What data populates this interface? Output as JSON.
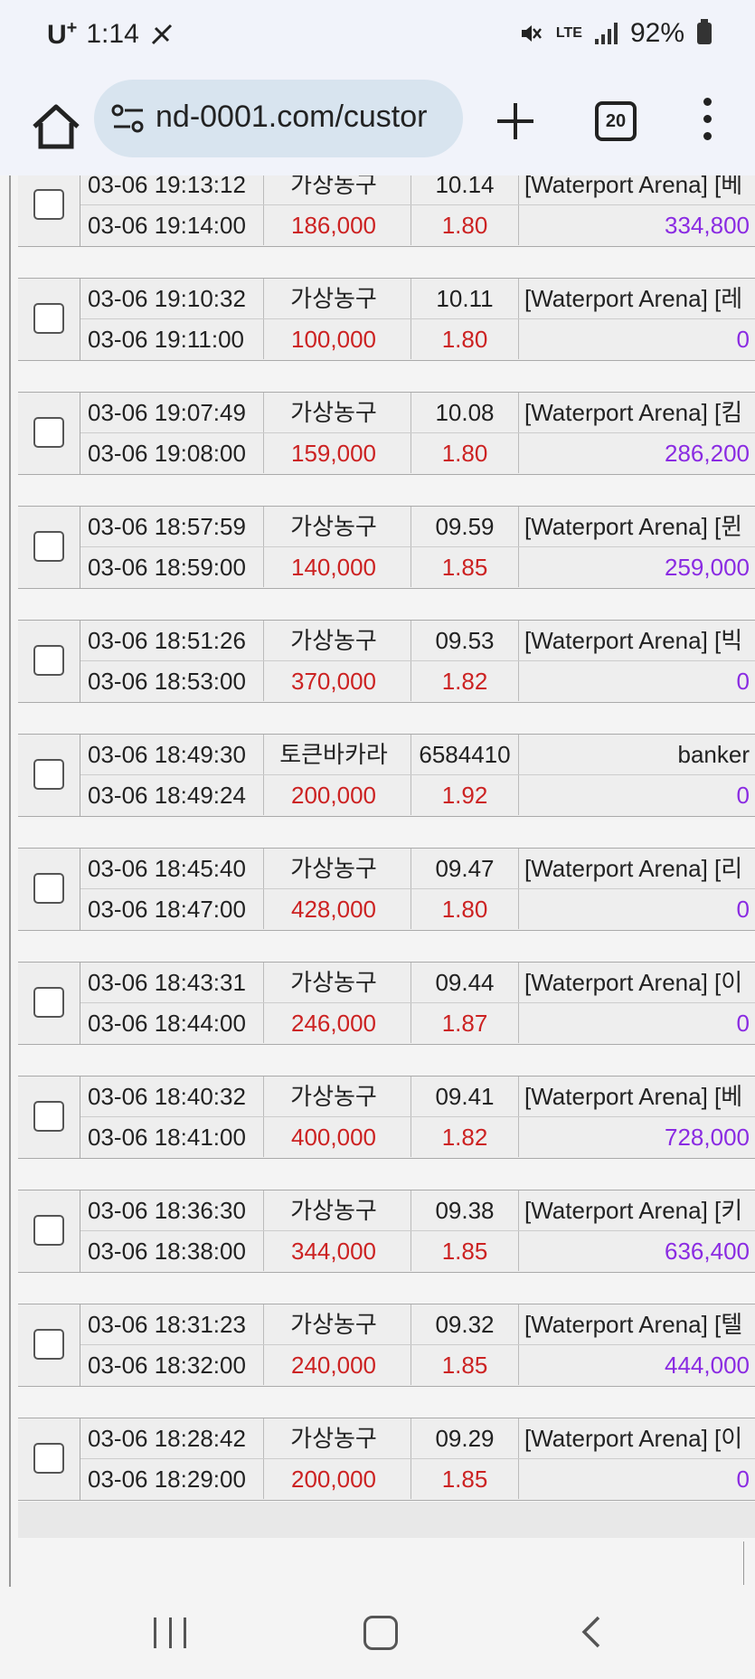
{
  "status_bar": {
    "carrier": "U",
    "carrier_sup": "+",
    "time": "1:14",
    "network": "LTE",
    "battery": "92%"
  },
  "browser": {
    "url": "nd-0001.com/custor",
    "tab_count": "20"
  },
  "rows": [
    {
      "time1": "03-06 19:13:12",
      "game": "가상농구",
      "code": "10.14",
      "desc": "[Waterport Arena] [베",
      "time2": "03-06 19:14:00",
      "amount": "186,000",
      "odds": "1.80",
      "payout": "334,800"
    },
    {
      "time1": "03-06 19:10:32",
      "game": "가상농구",
      "code": "10.11",
      "desc": "[Waterport Arena] [레",
      "time2": "03-06 19:11:00",
      "amount": "100,000",
      "odds": "1.80",
      "payout": "0"
    },
    {
      "time1": "03-06 19:07:49",
      "game": "가상농구",
      "code": "10.08",
      "desc": "[Waterport Arena] [킴",
      "time2": "03-06 19:08:00",
      "amount": "159,000",
      "odds": "1.80",
      "payout": "286,200"
    },
    {
      "time1": "03-06 18:57:59",
      "game": "가상농구",
      "code": "09.59",
      "desc": "[Waterport Arena] [뮌",
      "time2": "03-06 18:59:00",
      "amount": "140,000",
      "odds": "1.85",
      "payout": "259,000"
    },
    {
      "time1": "03-06 18:51:26",
      "game": "가상농구",
      "code": "09.53",
      "desc": "[Waterport Arena] [빅",
      "time2": "03-06 18:53:00",
      "amount": "370,000",
      "odds": "1.82",
      "payout": "0"
    },
    {
      "time1": "03-06 18:49:30",
      "game": "토큰바카라",
      "code": "6584410",
      "desc": "banker",
      "time2": "03-06 18:49:24",
      "amount": "200,000",
      "odds": "1.92",
      "payout": "0"
    },
    {
      "time1": "03-06 18:45:40",
      "game": "가상농구",
      "code": "09.47",
      "desc": "[Waterport Arena] [리",
      "time2": "03-06 18:47:00",
      "amount": "428,000",
      "odds": "1.80",
      "payout": "0"
    },
    {
      "time1": "03-06 18:43:31",
      "game": "가상농구",
      "code": "09.44",
      "desc": "[Waterport Arena] [이",
      "time2": "03-06 18:44:00",
      "amount": "246,000",
      "odds": "1.87",
      "payout": "0"
    },
    {
      "time1": "03-06 18:40:32",
      "game": "가상농구",
      "code": "09.41",
      "desc": "[Waterport Arena] [베",
      "time2": "03-06 18:41:00",
      "amount": "400,000",
      "odds": "1.82",
      "payout": "728,000"
    },
    {
      "time1": "03-06 18:36:30",
      "game": "가상농구",
      "code": "09.38",
      "desc": "[Waterport Arena] [키",
      "time2": "03-06 18:38:00",
      "amount": "344,000",
      "odds": "1.85",
      "payout": "636,400"
    },
    {
      "time1": "03-06 18:31:23",
      "game": "가상농구",
      "code": "09.32",
      "desc": "[Waterport Arena] [텔",
      "time2": "03-06 18:32:00",
      "amount": "240,000",
      "odds": "1.85",
      "payout": "444,000"
    },
    {
      "time1": "03-06 18:28:42",
      "game": "가상농구",
      "code": "09.29",
      "desc": "[Waterport Arena] [이",
      "time2": "03-06 18:29:00",
      "amount": "200,000",
      "odds": "1.85",
      "payout": "0"
    }
  ],
  "colors": {
    "amount": "#cc2222",
    "payout": "#8a2be2",
    "url_bar": "#d8e4ef"
  }
}
